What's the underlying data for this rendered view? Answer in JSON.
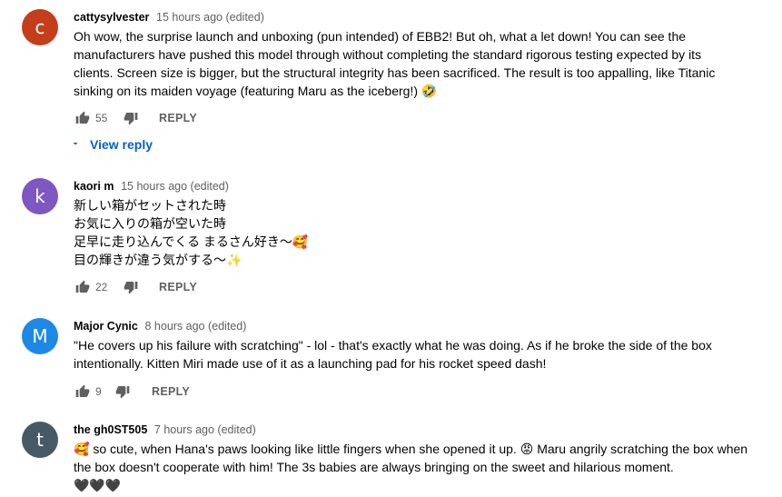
{
  "comments": [
    {
      "initial": "c",
      "avatar_color": "#c43e1c",
      "author": "cattysylvester",
      "time": "15 hours ago (edited)",
      "lines": [
        "Oh wow, the surprise launch and unboxing (pun intended) of EBB2! But oh, what a let down! You can see the",
        "manufacturers have pushed this model through without completing the standard rigorous testing expected by its",
        "clients. Screen size is bigger,  but the structural integrity has been sacrificed. The result is too appalling, like Titanic",
        "sinking on its maiden voyage (featuring Maru as the iceberg!) 🤣"
      ],
      "likes": "55",
      "reply_label": "REPLY"
    },
    {
      "initial": "k",
      "avatar_color": "#7e57c2",
      "author": "kaori m",
      "time": "15 hours ago (edited)",
      "lines": [
        "新しい箱がセットされた時",
        "お気に入りの箱が空いた時",
        "足早に走り込んでくる まるさん好き〜🥰",
        "目の輝きが違う気がする〜✨"
      ],
      "likes": "22",
      "reply_label": "REPLY"
    },
    {
      "initial": "M",
      "avatar_color": "#1e88e5",
      "author": "Major Cynic",
      "time": "8 hours ago (edited)",
      "lines": [
        "\"He covers up his failure with scratching\" - lol - that's exactly what he was doing. As if he broke the side of the box",
        "intentionally. Kitten Miri made use of it as a launching pad for his rocket speed dash!"
      ],
      "likes": "9",
      "reply_label": "REPLY"
    },
    {
      "initial": "t",
      "avatar_color": "#455a64",
      "author": "the gh0ST505",
      "time": "7 hours ago (edited)",
      "lines": [
        "🥰 so cute, when Hana's paws looking like little fingers when she opened it up. 😡 Maru angrily scratching the box when",
        "the box doesn't cooperate with him! The 3s babies are always bringing on the sweet and hilarious moment.",
        "🖤🖤🖤"
      ]
    }
  ],
  "view_replies_label": "View reply",
  "colors": {
    "link": "#065fd4",
    "meta": "#606060"
  }
}
